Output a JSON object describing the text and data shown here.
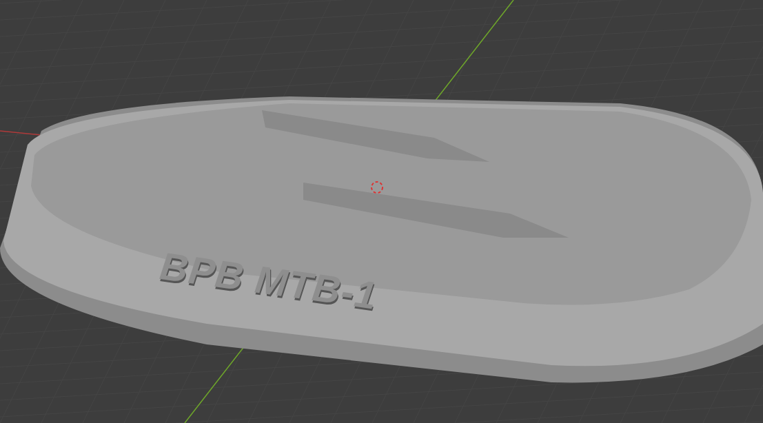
{
  "viewport": {
    "model_label": "BPB MTB-1"
  }
}
